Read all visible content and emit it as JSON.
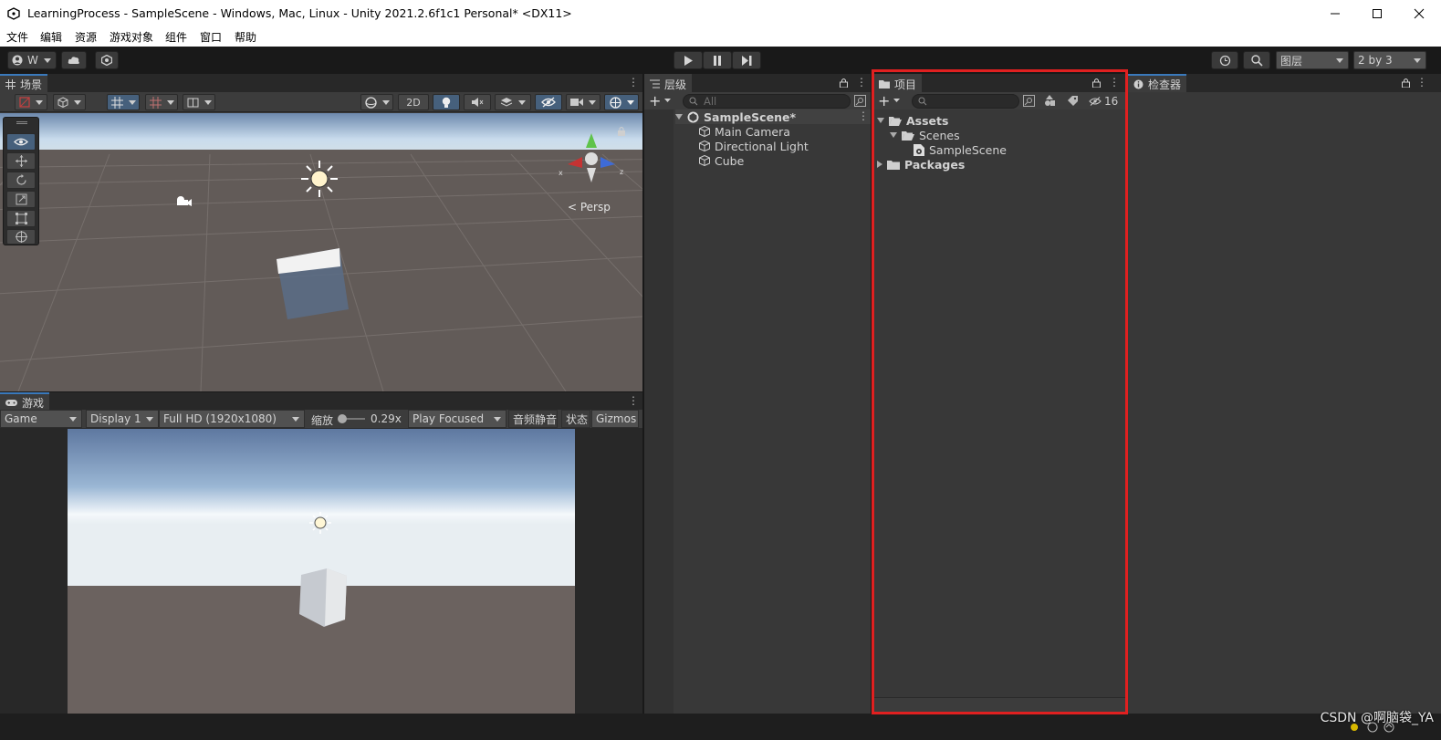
{
  "window": {
    "title": "LearningProcess - SampleScene - Windows, Mac, Linux - Unity 2021.2.6f1c1 Personal* <DX11>"
  },
  "menu": [
    "文件",
    "编辑",
    "资源",
    "游戏对象",
    "组件",
    "窗口",
    "帮助"
  ],
  "toolbar": {
    "account": "W",
    "layers": "图层",
    "layout": "2 by 3"
  },
  "scene": {
    "tab": "场景",
    "btn_2d": "2D",
    "persp_label": "< Persp",
    "gizmo_x": "x",
    "gizmo_z": "z"
  },
  "game": {
    "tab": "游戏",
    "display_mode": "Game",
    "display": "Display 1",
    "resolution": "Full HD (1920x1080)",
    "scale_label": "缩放",
    "scale_value": "0.29x",
    "play_mode": "Play Focused",
    "mute": "音频静音",
    "stats": "状态",
    "gizmos": "Gizmos"
  },
  "hierarchy": {
    "tab": "层级",
    "search_placeholder": "All",
    "scene": "SampleScene*",
    "items": [
      "Main Camera",
      "Directional Light",
      "Cube"
    ]
  },
  "project": {
    "tab": "项目",
    "hidden_count": "16",
    "assets": "Assets",
    "scenes": "Scenes",
    "scene_file": "SampleScene",
    "packages": "Packages"
  },
  "inspector": {
    "tab": "检查器"
  },
  "annotation": {
    "color": "#e02020"
  },
  "watermark": "CSDN @啊脑袋_YA"
}
